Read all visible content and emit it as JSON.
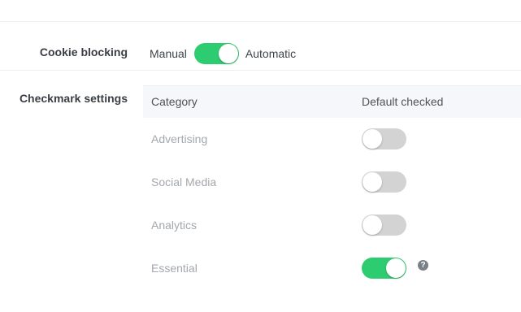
{
  "cookie_blocking": {
    "label": "Cookie blocking",
    "left_option": "Manual",
    "right_option": "Automatic",
    "automatic_enabled": true
  },
  "checkmark_settings": {
    "label": "Checkmark settings",
    "columns": [
      "Category",
      "Default checked"
    ],
    "rows": [
      {
        "category": "Advertising",
        "default_checked": false
      },
      {
        "category": "Social Media",
        "default_checked": false
      },
      {
        "category": "Analytics",
        "default_checked": false
      },
      {
        "category": "Essential",
        "default_checked": true,
        "help_icon": "question-circle-icon"
      }
    ]
  },
  "colors": {
    "toggle_on": "#2ecc71",
    "toggle_off": "#d3d3d3",
    "header_bg": "#f5f7fa"
  }
}
